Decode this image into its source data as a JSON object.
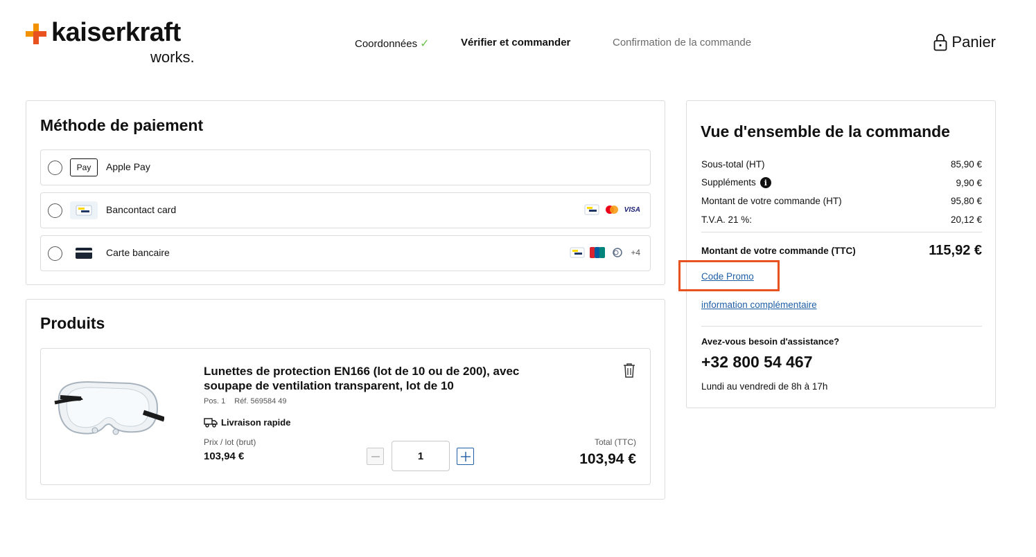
{
  "brand": {
    "name": "kaiserkraft",
    "tagline": "works.",
    "accent_orange": "#f39200",
    "accent_red": "#e8521f"
  },
  "steps": [
    {
      "label": "Coordonnées",
      "state": "done"
    },
    {
      "label": "Vérifier et commander",
      "state": "active"
    },
    {
      "label": "Confirmation de la commande",
      "state": "upcoming"
    }
  ],
  "cart": {
    "label": "Panier",
    "icon": "lock-icon"
  },
  "payment": {
    "title": "Méthode de paiement",
    "options": [
      {
        "label": "Apple Pay",
        "logo_text": "Pay",
        "brands": [],
        "more": ""
      },
      {
        "label": "Bancontact card",
        "logo_text": "",
        "brands": [
          "bancontact",
          "mastercard",
          "VISA"
        ],
        "more": ""
      },
      {
        "label": "Carte bancaire",
        "logo_text": "",
        "brands": [
          "bancontact",
          "unionpay",
          "diners"
        ],
        "more": "+4"
      }
    ]
  },
  "products": {
    "title": "Produits",
    "items": [
      {
        "name": "Lunettes de protection EN166 (lot de 10 ou de 200), avec soupape de ventilation transparent, lot de 10",
        "pos": "Pos. 1",
        "ref": "Réf. 569584 49",
        "delivery": "Livraison rapide",
        "price_label": "Prix / lot (brut)",
        "price": "103,94 €",
        "quantity": "1",
        "total_label": "Total (TTC)",
        "total": "103,94 €"
      }
    ]
  },
  "summary": {
    "title": "Vue d'ensemble de la commande",
    "rows": [
      {
        "label": "Sous-total (HT)",
        "value": "85,90 €"
      },
      {
        "label": "Suppléments",
        "value": "9,90 €"
      },
      {
        "label": "Montant de votre commande (HT)",
        "value": "95,80 €"
      },
      {
        "label": "T.V.A. 21 %:",
        "value": "20,12 €"
      }
    ],
    "total_label": "Montant de votre commande (TTC)",
    "total_value": "115,92 €",
    "promo_link": "Code Promo",
    "info_link": "information complémentaire",
    "help_title": "Avez-vous besoin d'assistance?",
    "help_phone": "+32 800 54 467",
    "help_hours": "Lundi au vendredi de 8h à 17h"
  }
}
